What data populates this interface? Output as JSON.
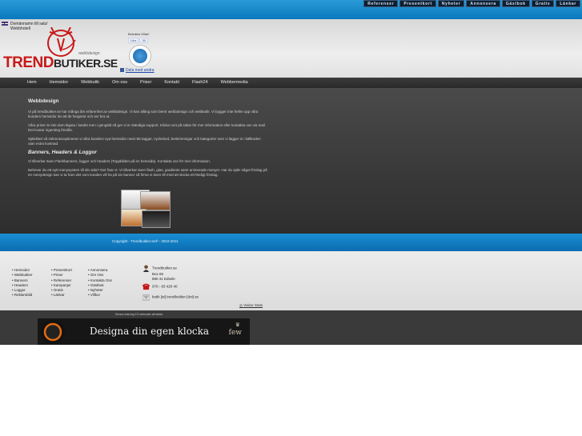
{
  "topnav": [
    "Referenser",
    "Presentkort",
    "Nyheter",
    "Annonsera",
    "Gästbok",
    "Gratis",
    "Länkar"
  ],
  "header": {
    "lang_line1": "Domännamn till salu!",
    "lang_line2": "Webbhotell",
    "logo_main": "TREND",
    "logo_suffix": "BUTIKER.SE",
    "logo_sub": "webbdesign",
    "social_label": "Betrakta Gillar!",
    "like_label": "Like",
    "like_count": "30",
    "share_label": "Dela med andra"
  },
  "mainnav": [
    "Hem",
    "Hemsidor",
    "Webbutik",
    "Om oss",
    "Priser",
    "Kontakt",
    "Flash24",
    "Webbermedia"
  ],
  "content": {
    "title": "Webbdesign",
    "p1": "Vi på trendbutiker.se har många års erfarenhet av webbdesign. Vi kan allting som berör webbdesign och webbutik. Vi bygger inte hellre upp våra kunders hemsidor än att de fungerar och ser bra ut.",
    "p2": "Våra priser är inte dom lägsta i landet men i gengäld så ger vi er ständiga support. Klicka runt på sidan för mer information eller kontakta oss via mail. Det kostar ingenting förstås.",
    "p3": "Självklart så sökmotoroptimerar vi våra kunders nya hemsidor med rätt taggar, nyckelord, beskrivningar och kategorier som vi lägger in i källkoden utan extra kostnad.",
    "subtitle": "Banners, Headers & Loggor",
    "p4": "Vi tillverkar även Flashbanners, loggor och headers (Toppbilden på en hemsida). Kontakta oss för mer information.",
    "p5": "Behöver du ett nytt menysystem till din sida? Det fixar vi. Vi tillverkar även flash, glas, gradients samt animerade menyer. Har du själv något förslag på en menydesign kan vi ta fram det som kunden vill ha på sin banner så firma vi även till med att skicka ett färdigt förslag."
  },
  "copyright": "Copyright - Trendbutiker.se® - 2010-2011",
  "footer": {
    "col1": [
      "Hemsidor",
      "Webbutiker",
      "Banners",
      "Headers",
      "Loggor",
      "Reklambild"
    ],
    "col2": [
      "Presentkort",
      "Priser",
      "Referenser",
      "Kampanjer",
      "Gratis",
      "Länkar"
    ],
    "col3": [
      "Annonsera",
      "Om Oss",
      "Kontakta Oss",
      "Gästbok",
      "Nyheter",
      "Villkor"
    ],
    "contact": {
      "name": "Trendbutiker.se",
      "box": "Box 65",
      "city": "880 41 Edsele",
      "phone": "070 - 83 420 40",
      "email": "butik [at] trendbutiker [dot] se"
    },
    "visit_label": "Visitor Stats"
  },
  "bottom": {
    "load_time": "Denna sida tog 2.5 sekunder att ladda",
    "banner_text": "Designa din egen klocka",
    "banner_brand": "few"
  },
  "colors": {
    "top_blue": "#0a78bd",
    "logo_red": "#c81818",
    "nav_dark": "#2a2a2a",
    "content_dark": "#3a3a3a"
  }
}
